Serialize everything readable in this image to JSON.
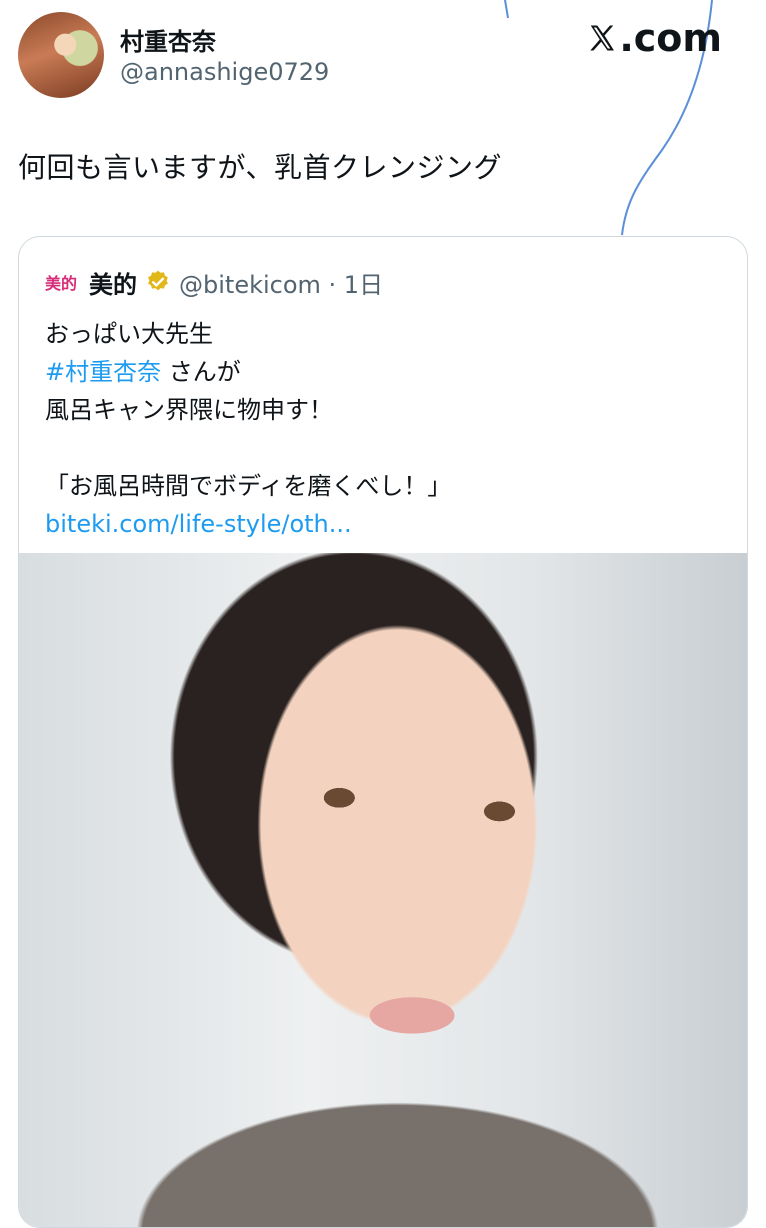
{
  "author": {
    "display_name": "村重杏奈",
    "handle": "@annashige0729"
  },
  "site_brand": ".com",
  "tweet": {
    "text": "何回も言いますが、乳首クレンジング"
  },
  "quoted": {
    "logo_text": "美的",
    "name": "美的",
    "handle_time": "@bitekicom · 1日",
    "lines": {
      "l1": "おっぱい大先生",
      "l2_hashtag": "#村重杏奈",
      "l2_rest": " さんが",
      "l3": "風呂キャン界隈に物申す！",
      "l5": "「お風呂時間でボディを磨くべし！」",
      "link": "biteki.com/life-style/oth..."
    },
    "image_icon": "portrait-photo"
  },
  "colors": {
    "link": "#1d9bf0",
    "secondary_text": "#536471",
    "border": "#cfd9de",
    "verified_gold": "#e2b719",
    "logo_pink": "#d62c7a"
  }
}
